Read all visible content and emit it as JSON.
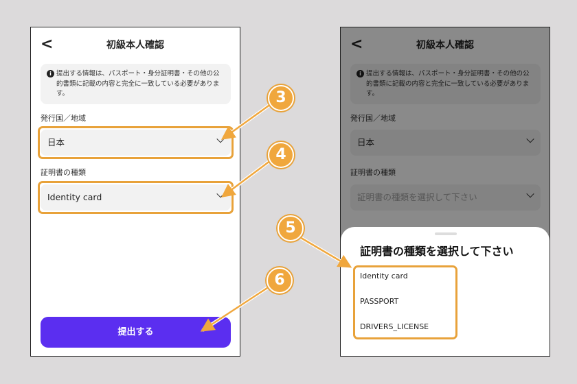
{
  "left_screen": {
    "back_glyph": "<",
    "title": "初級本人確認",
    "info_text": "提出する情報は、パスポート・身分証明書・その他の公的書類に記載の内容と完全に一致している必要があります。",
    "country_label": "発行国／地域",
    "country_value": "日本",
    "doc_label": "証明書の種類",
    "doc_value": "Identity card",
    "submit_label": "提出する"
  },
  "right_screen": {
    "back_glyph": "<",
    "title": "初級本人確認",
    "info_text": "提出する情報は、パスポート・身分証明書・その他の公的書類に記載の内容と完全に一致している必要があります。",
    "country_label": "発行国／地域",
    "country_value": "日本",
    "doc_label": "証明書の種類",
    "doc_placeholder": "証明書の種類を選択して下さい",
    "sheet_title": "証明書の種類を選択して下さい",
    "options": [
      "Identity card",
      "PASSPORT",
      "DRIVERS_LICENSE"
    ]
  },
  "callouts": [
    "3",
    "4",
    "5",
    "6"
  ],
  "colors": {
    "accent": "#5b2ef0",
    "highlight": "#e8a23a",
    "badge": "#f0a73d"
  }
}
